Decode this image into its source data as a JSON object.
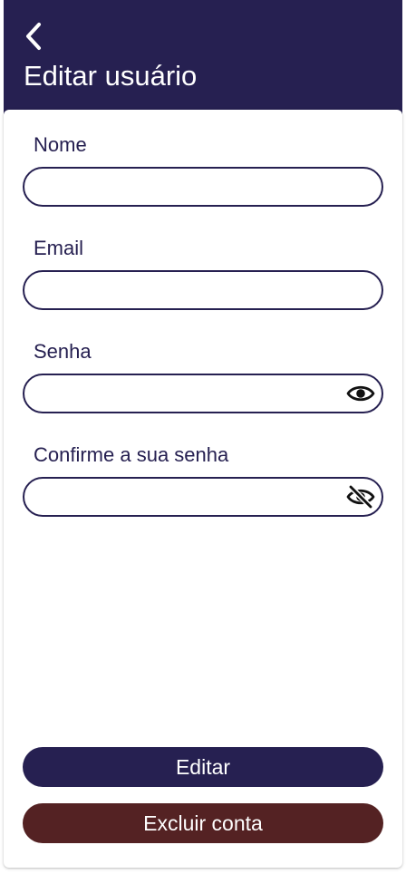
{
  "header": {
    "title": "Editar usuário",
    "back_icon": "chevron-left-icon",
    "background_color": "#262051"
  },
  "form": {
    "name": {
      "label": "Nome",
      "value": ""
    },
    "email": {
      "label": "Email",
      "value": ""
    },
    "password": {
      "label": "Senha",
      "value": "",
      "toggle_icon": "eye-icon"
    },
    "confirm_password": {
      "label": "Confirme a sua senha",
      "value": "",
      "toggle_icon": "eye-off-icon"
    }
  },
  "actions": {
    "edit_label": "Editar",
    "edit_color": "#262051",
    "delete_label": "Excluir conta",
    "delete_color": "#542223"
  }
}
